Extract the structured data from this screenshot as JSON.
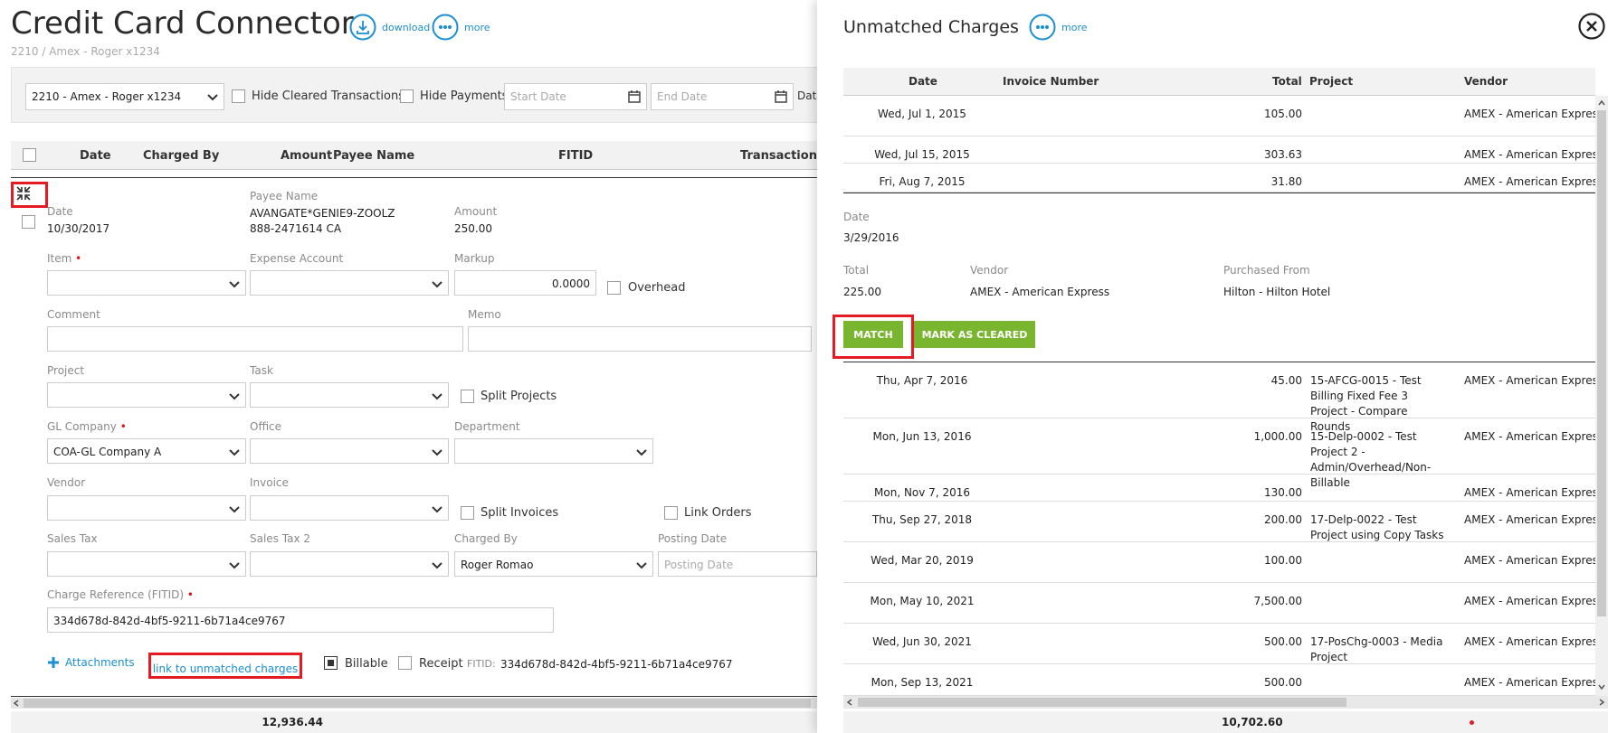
{
  "left": {
    "title": "Credit Card Connector",
    "subtitle": "2210 / Amex - Roger x1234",
    "download_label": "download",
    "more_label": "more",
    "filters": {
      "account": "2210 - Amex - Roger x1234",
      "hide_cleared": "Hide Cleared Transactions",
      "hide_payments": "Hide Payments",
      "start_date_ph": "Start Date",
      "end_date_ph": "End Date",
      "date_cut": "Date"
    },
    "columns": [
      "Date",
      "Charged By",
      "Amount",
      "Payee Name",
      "FITID",
      "Transaction Ty"
    ],
    "detail": {
      "date_label": "Date",
      "date": "10/30/2017",
      "payee_label": "Payee Name",
      "payee_line1": "AVANGATE*GENIE9-ZOOLZ",
      "payee_line2": "888-2471614 CA",
      "amount_label": "Amount",
      "amount": "250.00",
      "item_label": "Item",
      "expense_label": "Expense Account",
      "markup_label": "Markup",
      "markup": "0.0000",
      "overhead": "Overhead",
      "comment_label": "Comment",
      "memo_label": "Memo",
      "project_label": "Project",
      "task_label": "Task",
      "split_projects": "Split Projects",
      "gl_label": "GL Company",
      "gl_value": "COA-GL Company A",
      "office_label": "Office",
      "department_label": "Department",
      "vendor_label": "Vendor",
      "invoice_label": "Invoice",
      "split_invoices": "Split Invoices",
      "link_orders": "Link Orders",
      "sales_tax_label": "Sales Tax",
      "sales_tax2_label": "Sales Tax 2",
      "charged_by_label": "Charged By",
      "charged_by": "Roger Romao",
      "posting_label": "Posting Date",
      "posting_ph": "Posting Date",
      "fitid_label": "Charge Reference (FITID)",
      "fitid": "334d678d-842d-4bf5-9211-6b71a4ce9767",
      "attachments": "Attachments",
      "link_unmatched": "link to unmatched charges",
      "billable": "Billable",
      "receipt": "Receipt",
      "fitid_short": "FITID:",
      "fitid_value": "334d678d-842d-4bf5-9211-6b71a4ce9767"
    },
    "total": "12,936.44"
  },
  "right": {
    "title": "Unmatched Charges",
    "more_label": "more",
    "columns": {
      "date": "Date",
      "invoice": "Invoice Number",
      "total": "Total",
      "project": "Project",
      "vendor": "Vendor"
    },
    "top_rows": [
      {
        "date": "Wed, Jul 1, 2015",
        "total": "105.00",
        "project": "",
        "vendor": "AMEX - American Express"
      },
      {
        "date": "Wed, Jul 15, 2015",
        "total": "303.63",
        "project": "",
        "vendor": "AMEX - American Express"
      },
      {
        "date": "Fri, Aug 7, 2015",
        "total": "31.80",
        "project": "",
        "vendor": "AMEX - American Express"
      }
    ],
    "selected": {
      "date_label": "Date",
      "date": "3/29/2016",
      "total_label": "Total",
      "total": "225.00",
      "vendor_label": "Vendor",
      "vendor": "AMEX - American Express",
      "purchased_label": "Purchased From",
      "purchased": "Hilton - Hilton Hotel",
      "match": "MATCH",
      "mark_cleared": "MARK AS CLEARED"
    },
    "rows": [
      {
        "date": "Thu, Apr 7, 2016",
        "total": "45.00",
        "project": "15-AFCG-0015 - Test Billing Fixed Fee 3 Project - Compare Rounds",
        "vendor": "AMEX - American Express"
      },
      {
        "date": "Mon, Jun 13, 2016",
        "total": "1,000.00",
        "project": "15-Delp-0002 - Test Project 2 - Admin/Overhead/Non-Billable",
        "vendor": "AMEX - American Express"
      },
      {
        "date": "Mon, Nov 7, 2016",
        "total": "130.00",
        "project": "",
        "vendor": "AMEX - American Express"
      },
      {
        "date": "Thu, Sep 27, 2018",
        "total": "200.00",
        "project": "17-Delp-0022 - Test Project using Copy Tasks",
        "vendor": "AMEX - American Express"
      },
      {
        "date": "Wed, Mar 20, 2019",
        "total": "100.00",
        "project": "",
        "vendor": "AMEX - American Express"
      },
      {
        "date": "Mon, May 10, 2021",
        "total": "7,500.00",
        "project": "",
        "vendor": "AMEX - American Express"
      },
      {
        "date": "Wed, Jun 30, 2021",
        "total": "500.00",
        "project": "17-PosChg-0003 - Media Project",
        "vendor": "AMEX - American Express"
      },
      {
        "date": "Mon, Sep 13, 2021",
        "total": "500.00",
        "project": "",
        "vendor": "AMEX - American Express"
      }
    ],
    "total": "10,702.60"
  }
}
